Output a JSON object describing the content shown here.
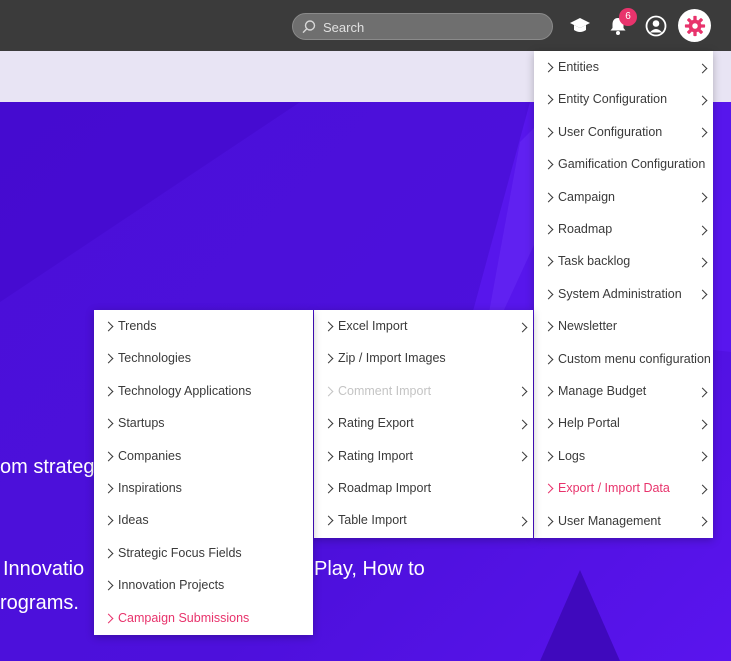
{
  "topbar": {
    "search_placeholder": "Search",
    "notification_count": "6",
    "icons": [
      "learning-icon",
      "bell-icon",
      "user-icon",
      "gear-icon"
    ],
    "accent": "#e8336c"
  },
  "hero": {
    "line1": "om strateg",
    "line2a": "Innovatio",
    "line2b": "Play, How to",
    "line3": "rograms."
  },
  "admin_menu": {
    "items": [
      {
        "label": "Entities",
        "submenu": true
      },
      {
        "label": "Entity Configuration",
        "submenu": true
      },
      {
        "label": "User Configuration",
        "submenu": true
      },
      {
        "label": "Gamification Configuration",
        "submenu": false
      },
      {
        "label": "Campaign",
        "submenu": true
      },
      {
        "label": "Roadmap",
        "submenu": true
      },
      {
        "label": "Task backlog",
        "submenu": true
      },
      {
        "label": "System Administration",
        "submenu": true
      },
      {
        "label": "Newsletter",
        "submenu": false
      },
      {
        "label": "Custom menu configuration",
        "submenu": false
      },
      {
        "label": "Manage Budget",
        "submenu": true
      },
      {
        "label": "Help Portal",
        "submenu": true
      },
      {
        "label": "Logs",
        "submenu": true
      },
      {
        "label": "Export / Import Data",
        "submenu": true,
        "active": true
      },
      {
        "label": "User Management",
        "submenu": true
      }
    ]
  },
  "export_menu": {
    "items": [
      {
        "label": "Excel Import",
        "submenu": true
      },
      {
        "label": "Zip / Import Images",
        "submenu": false
      },
      {
        "label": "Comment Import",
        "submenu": true,
        "disabled": true
      },
      {
        "label": "Rating Export",
        "submenu": true
      },
      {
        "label": "Rating Import",
        "submenu": true
      },
      {
        "label": "Roadmap Import",
        "submenu": false
      },
      {
        "label": "Table Import",
        "submenu": true
      }
    ]
  },
  "excel_menu": {
    "items": [
      {
        "label": "Trends"
      },
      {
        "label": "Technologies"
      },
      {
        "label": "Technology Applications"
      },
      {
        "label": "Startups"
      },
      {
        "label": "Companies"
      },
      {
        "label": "Inspirations"
      },
      {
        "label": "Ideas"
      },
      {
        "label": "Strategic Focus Fields"
      },
      {
        "label": "Innovation Projects"
      },
      {
        "label": "Campaign Submissions",
        "active": true
      }
    ]
  }
}
